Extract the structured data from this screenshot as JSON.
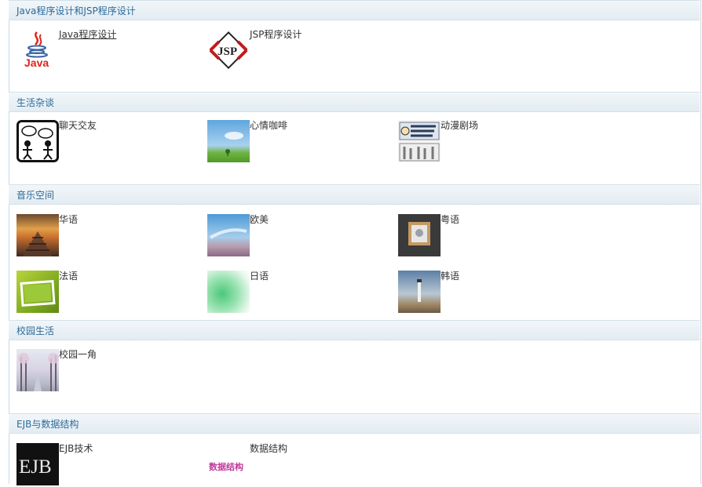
{
  "sections": [
    {
      "title": "Java程序设计和JSP程序设计",
      "items": [
        {
          "label": "Java程序设计",
          "icon": "java-logo-icon",
          "underline": true
        },
        {
          "label": "JSP程序设计",
          "icon": "jsp-logo-icon"
        }
      ]
    },
    {
      "title": "生活杂谈",
      "items": [
        {
          "label": "聊天交友",
          "icon": "chat-people-icon"
        },
        {
          "label": "心情咖啡",
          "icon": "sky-meadow-photo"
        },
        {
          "label": "动漫剧场",
          "icon": "one-piece-poster"
        }
      ]
    },
    {
      "title": "音乐空间",
      "items": [
        {
          "label": "华语",
          "icon": "pier-sunset-photo"
        },
        {
          "label": "欧美",
          "icon": "sky-flowers-photo"
        },
        {
          "label": "粤语",
          "icon": "photo-frame-photo"
        },
        {
          "label": "法语",
          "icon": "green-frame-photo"
        },
        {
          "label": "日语",
          "icon": "green-bokeh-photo"
        },
        {
          "label": "韩语",
          "icon": "lighthouse-photo"
        }
      ]
    },
    {
      "title": "校园生活",
      "items": [
        {
          "label": "校园一角",
          "icon": "campus-photo"
        }
      ]
    },
    {
      "title": "EJB与数据结构",
      "items": [
        {
          "label": "EJB技术",
          "icon": "ejb-logo-icon",
          "logo_text": "EJB"
        },
        {
          "label": "数据结构",
          "icon": "data-structure-logo",
          "logo_text": "数据结构"
        }
      ]
    }
  ]
}
